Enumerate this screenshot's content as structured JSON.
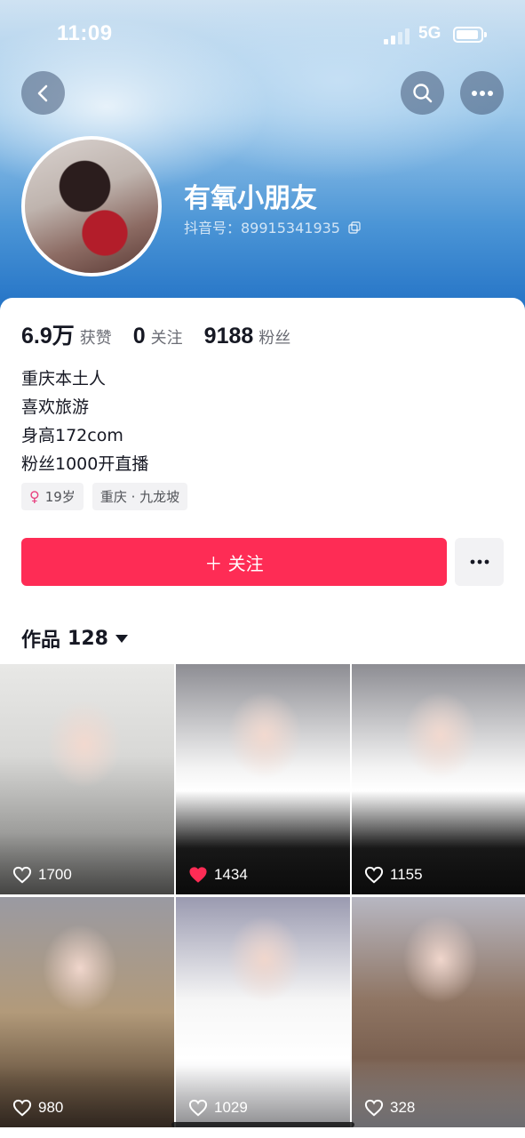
{
  "status_bar": {
    "time": "11:09",
    "network": "5G"
  },
  "profile": {
    "username": "有氧小朋友",
    "douyin_id": "抖音号：89915341935"
  },
  "stats": [
    {
      "value": "6.9万",
      "label": "获赞"
    },
    {
      "value": "0",
      "label": "关注"
    },
    {
      "value": "9188",
      "label": "粉丝"
    }
  ],
  "bio": [
    "重庆本土人",
    "喜欢旅游",
    "身高172com",
    "粉丝1000开直播"
  ],
  "tags": {
    "gender_symbol": "♀",
    "age": "19岁",
    "location": "重庆 · 九龙坡"
  },
  "actions": {
    "follow_label": "＋ 关注"
  },
  "works": {
    "label": "作品",
    "count": "128"
  },
  "videos": [
    {
      "likes": "1700",
      "liked": false
    },
    {
      "likes": "1434",
      "liked": true
    },
    {
      "likes": "1155",
      "liked": false
    },
    {
      "likes": "980",
      "liked": false
    },
    {
      "likes": "1029",
      "liked": false
    },
    {
      "likes": "328",
      "liked": false
    }
  ],
  "colors": {
    "accent": "#fe2c55",
    "text": "#161823",
    "secondary": "#6b6d75"
  }
}
